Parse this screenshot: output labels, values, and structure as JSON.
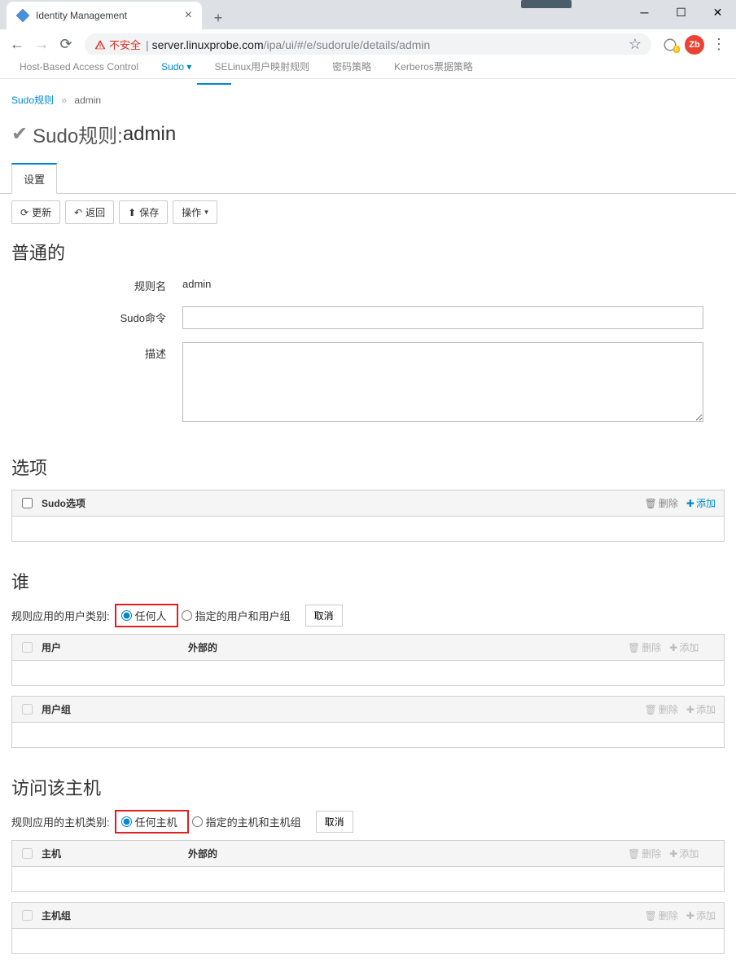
{
  "browser": {
    "tab_title": "Identity Management",
    "security_warning": "不安全",
    "url_host": "server.linuxprobe.com",
    "url_path": "/ipa/ui/#/e/sudorule/details/admin"
  },
  "page_nav": {
    "items": [
      "Host-Based Access Control",
      "Sudo",
      "SELinux用户映射规则",
      "密码策略",
      "Kerberos票据策略"
    ]
  },
  "breadcrumb": {
    "parent": "Sudo规则",
    "current": "admin"
  },
  "title": {
    "prefix": "Sudo规则: ",
    "name": "admin"
  },
  "subtab": "设置",
  "buttons": {
    "refresh": "更新",
    "back": "返回",
    "save": "保存",
    "actions": "操作"
  },
  "sections": {
    "general": {
      "heading": "普通的",
      "rule_name_label": "规则名",
      "rule_name_value": "admin",
      "sudo_order_label": "Sudo命令",
      "description_label": "描述"
    },
    "options": {
      "heading": "选项",
      "col": "Sudo选项",
      "delete": "删除",
      "add": "添加"
    },
    "who": {
      "heading": "谁",
      "category_label": "规则应用的用户类别:",
      "anyone": "任何人",
      "specified": "指定的用户和用户组",
      "cancel": "取消",
      "users_col": "用户",
      "external_col": "外部的",
      "groups_col": "用户组",
      "delete": "删除",
      "add": "添加"
    },
    "hosts": {
      "heading": "访问该主机",
      "category_label": "规则应用的主机类别:",
      "anyhost": "任何主机",
      "specified": "指定的主机和主机组",
      "cancel": "取消",
      "host_col": "主机",
      "external_col": "外部的",
      "hostgroup_col": "主机组",
      "delete": "删除",
      "add": "添加"
    }
  },
  "ext_badge": "6",
  "ext2_label": "Zb"
}
